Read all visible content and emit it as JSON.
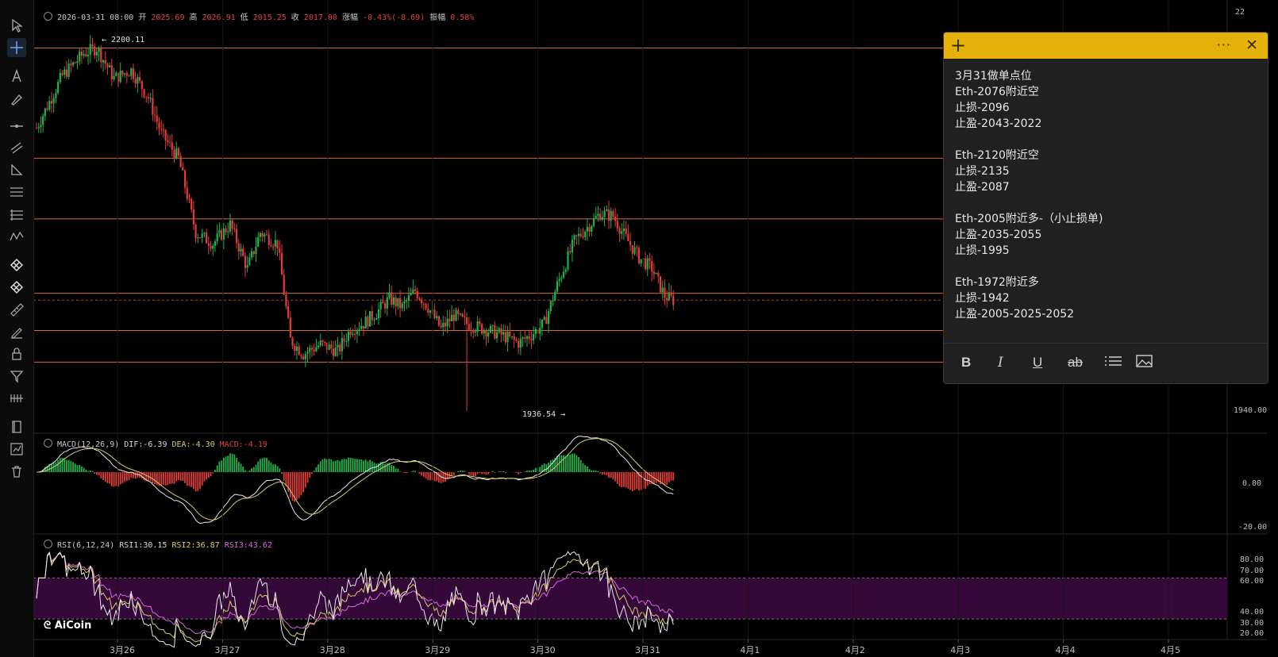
{
  "toolbar": {
    "icons": [
      "cursor-arrow-icon",
      "crosshair-icon",
      "text-tool-icon",
      "brush-icon",
      "horizontal-line-icon",
      "parallel-channel-icon",
      "triangle-tool-icon",
      "fib-retracement-icon",
      "pitchfork-icon",
      "wave-pattern-icon",
      "pattern-tool-icon",
      "pattern-tool-icon",
      "ruler-icon",
      "pen-icon",
      "lock-icon",
      "filter-icon",
      "indicator-icon",
      "book-icon",
      "chart-template-icon",
      "trash-icon"
    ]
  },
  "header": {
    "datetime": "2026-03-31 08:00",
    "open_label": "开",
    "open": "2025.69",
    "high_label": "高",
    "high": "2026.91",
    "low_label": "低",
    "low": "2015.25",
    "close_label": "收",
    "close": "2017.00",
    "change_label": "涨幅",
    "change": "-0.43%(-8.69)",
    "amplitude_label": "振幅",
    "amplitude": "0.58%"
  },
  "price_chart": {
    "high_marker": "← 2200.11",
    "low_marker": "1936.54 →",
    "axis_labels": [
      "1940.00"
    ],
    "top_axis_label": "22",
    "horizontal_levels": [
      2200,
      2120,
      2076,
      2022,
      1995,
      1972
    ],
    "current_price": 2017.0,
    "colors": {
      "up": "#22b14c",
      "down": "#e23b38",
      "level": "#d86a2c"
    }
  },
  "macd": {
    "title": "MACD(12,26,9)",
    "dif": "DIF:-6.39",
    "dea": "DEA:-4.30",
    "macd": "MACD:-4.19",
    "axis_labels": [
      "0.00",
      "-20.00"
    ]
  },
  "rsi": {
    "title": "RSI(6,12,24)",
    "rsi1": "RSI1:30.15",
    "rsi2": "RSI2:36.87",
    "rsi3": "RSI3:43.62",
    "axis_labels": [
      "80.00",
      "70.00",
      "60.00",
      "40.00",
      "30.00",
      "20.00"
    ],
    "band_color": "#3a0a3f"
  },
  "logo_text": "AiCoin",
  "date_axis": [
    "3月26",
    "3月27",
    "3月28",
    "3月29",
    "3月30",
    "3月31",
    "4月1",
    "4月2",
    "4月3",
    "4月4",
    "4月5"
  ],
  "note": {
    "lines": [
      "3月31做单点位",
      "Eth-2076附近空",
      "止损-2096",
      "止盈-2043-2022",
      "",
      "Eth-2120附近空",
      "止损-2135",
      "止盈-2087",
      "",
      "Eth-2005附近多-（小止损单)",
      "止盈-2035-2055",
      "止损-1995",
      "",
      "Eth-1972附近多",
      "止损-1942",
      "止盈-2005-2025-2052"
    ],
    "header_plus": "+",
    "header_more": "···",
    "header_close": "✕",
    "format_buttons": [
      "B",
      "I",
      "U",
      "ab",
      "list",
      "image"
    ]
  }
}
